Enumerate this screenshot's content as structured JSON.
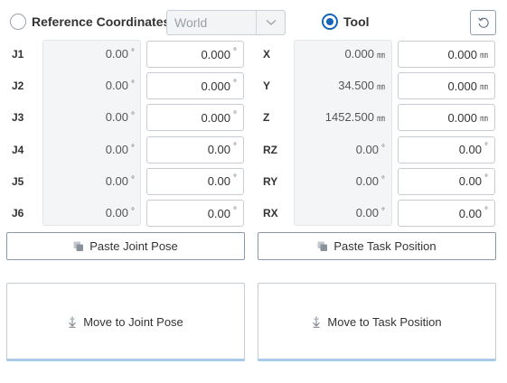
{
  "header": {
    "reference_radio_label": "Reference Coordinates",
    "reference_select_value": "World",
    "tool_radio_label": "Tool"
  },
  "joints": {
    "rows": [
      {
        "label": "J1",
        "current": "0.00",
        "target": "0.000",
        "unit": "°"
      },
      {
        "label": "J2",
        "current": "0.00",
        "target": "0.000",
        "unit": "°"
      },
      {
        "label": "J3",
        "current": "0.00",
        "target": "0.000",
        "unit": "°"
      },
      {
        "label": "J4",
        "current": "0.00",
        "target": "0.00",
        "unit": "°"
      },
      {
        "label": "J5",
        "current": "0.00",
        "target": "0.00",
        "unit": "°"
      },
      {
        "label": "J6",
        "current": "0.00",
        "target": "0.00",
        "unit": "°"
      }
    ],
    "paste_label": "Paste Joint Pose",
    "move_label": "Move to Joint Pose"
  },
  "task": {
    "rows": [
      {
        "label": "X",
        "current": "0.000",
        "target": "0.000",
        "unit": "㎜"
      },
      {
        "label": "Y",
        "current": "34.500",
        "target": "0.000",
        "unit": "㎜"
      },
      {
        "label": "Z",
        "current": "1452.500",
        "target": "0.000",
        "unit": "㎜"
      },
      {
        "label": "RZ",
        "current": "0.00",
        "target": "0.00",
        "unit": "°"
      },
      {
        "label": "RY",
        "current": "0.00",
        "target": "0.00",
        "unit": "°"
      },
      {
        "label": "RX",
        "current": "0.00",
        "target": "0.00",
        "unit": "°"
      }
    ],
    "paste_label": "Paste Task Position",
    "move_label": "Move to Task Position"
  },
  "icons": {
    "select_arrow": "chevron-down-icon",
    "reset": "reset-icon",
    "paste": "copy-icon",
    "move": "move-down-icon"
  },
  "colors": {
    "accent": "#1565b8",
    "move_button_underline": "#a9cbea",
    "readonly_panel": "#f4f5f6"
  }
}
